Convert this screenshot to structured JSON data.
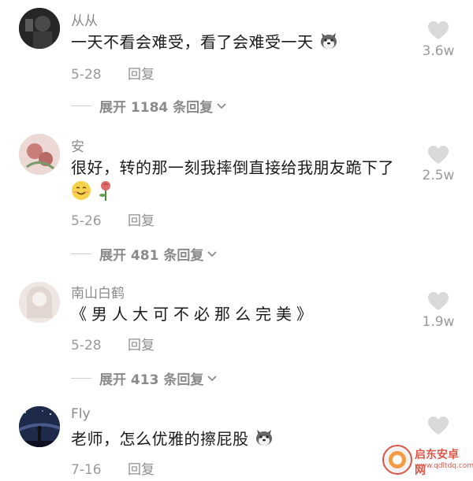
{
  "comments": [
    {
      "username": "从从",
      "text": "一天不看会难受，看了会难受一天",
      "date": "5-28",
      "reply_label": "回复",
      "likes": "3.6w",
      "expand_label": "展开 1184 条回复"
    },
    {
      "username": "安",
      "text": "很好，转的那一刻我摔倒直接给我朋友跪下了",
      "date": "5-26",
      "reply_label": "回复",
      "likes": "2.5w",
      "expand_label": "展开 481 条回复"
    },
    {
      "username": "南山白鹤",
      "text": "《男人大可不必那么完美》",
      "date": "5-28",
      "reply_label": "回复",
      "likes": "1.9w",
      "expand_label": "展开 413 条回复"
    },
    {
      "username": "Fly",
      "text": "老师，怎么优雅的擦屁股",
      "date": "7-16",
      "reply_label": "回复",
      "likes": ""
    }
  ],
  "watermark": {
    "title": "启东安卓网",
    "url": "www.qdltdq.com"
  },
  "colors": {
    "text": "#1a1a1a",
    "muted": "#9a9a9a",
    "heart": "#d9d9d9",
    "watermark": "#d23b2a"
  }
}
